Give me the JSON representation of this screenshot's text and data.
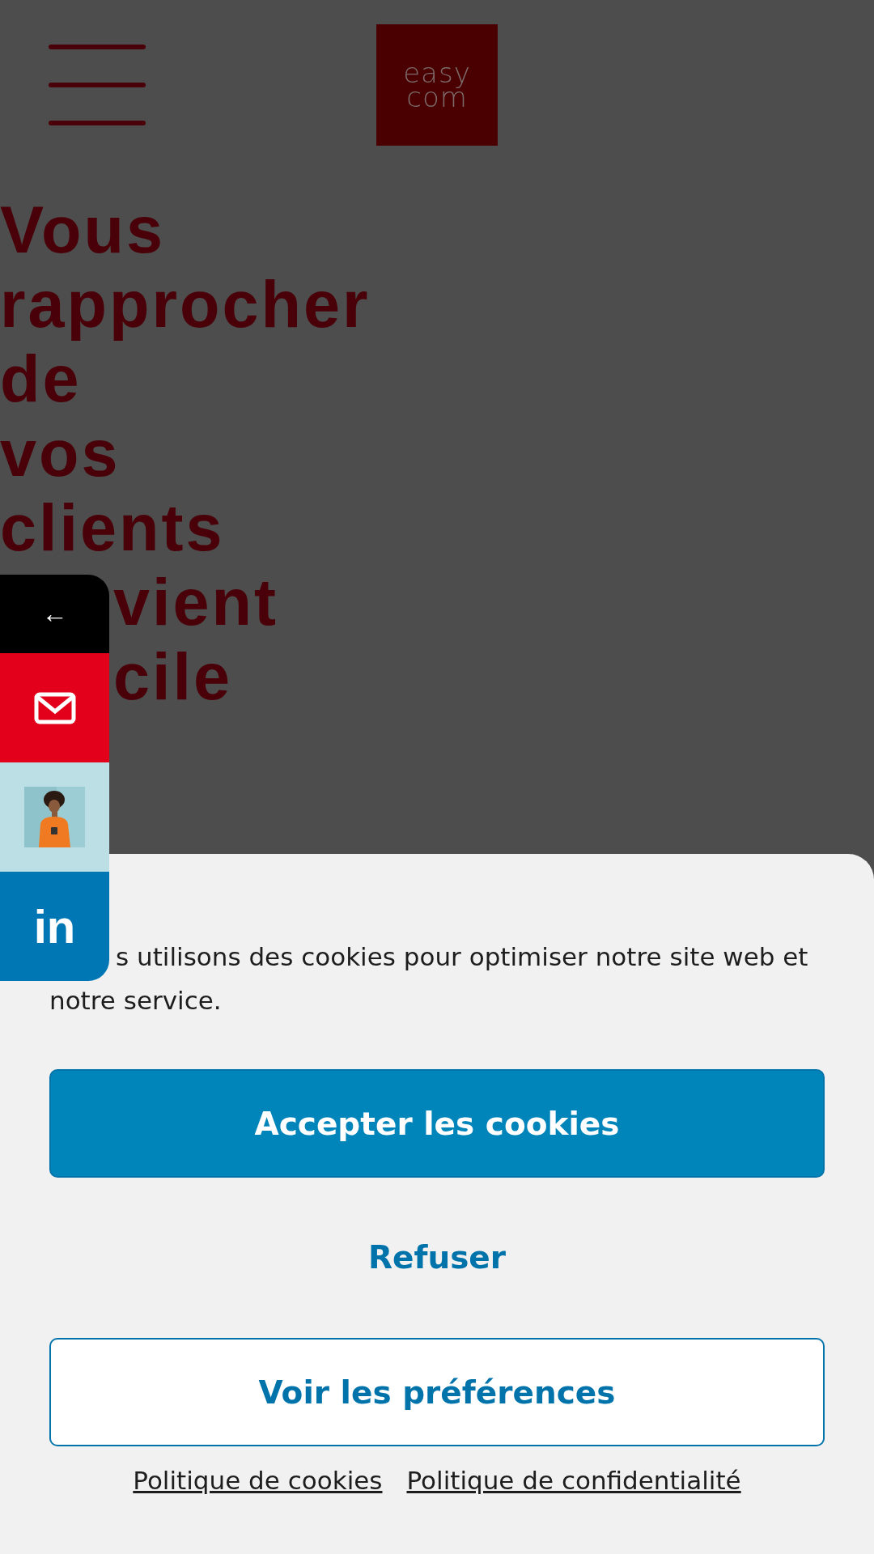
{
  "header": {
    "logo": [
      "easy",
      "com"
    ]
  },
  "hero": {
    "heading_lines": [
      "Vous",
      "rapprocher",
      "de",
      "vos",
      "clients",
      "vient",
      "cile"
    ]
  },
  "side_bar": {
    "items": [
      {
        "kind": "arrow",
        "label": "←"
      },
      {
        "kind": "mail"
      },
      {
        "kind": "picture"
      },
      {
        "kind": "linkedin",
        "label": "in"
      }
    ]
  },
  "cookie_banner": {
    "message": "s utilisons des cookies pour optimiser notre site web et notre service.",
    "accept": "Accepter les cookies",
    "refuse": "Refuser",
    "preferences": "Voir les préférences",
    "links": [
      "Politique de cookies",
      "Politique de confidentialité"
    ]
  }
}
